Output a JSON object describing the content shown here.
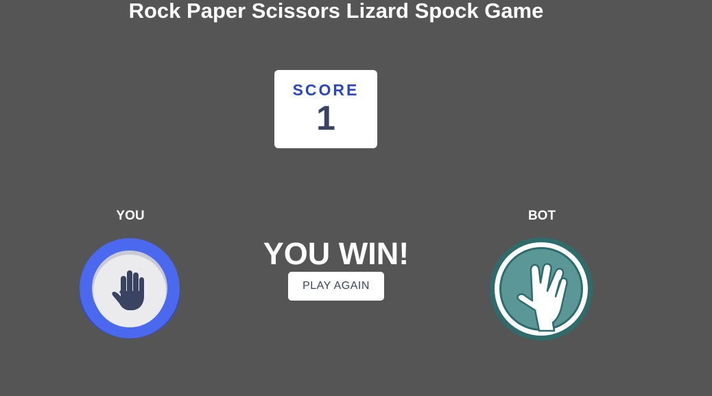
{
  "title": "Rock Paper Scissors Lizard Spock Game",
  "score": {
    "label": "SCORE",
    "value": "1"
  },
  "players": {
    "you_label": "YOU",
    "bot_label": "BOT"
  },
  "picks": {
    "you": "paper-icon",
    "bot": "spock-icon"
  },
  "result": {
    "text": "YOU WIN!",
    "button_label": "PLAY AGAIN"
  },
  "colors": {
    "background": "#555555",
    "paper_ring": "#4a69ee",
    "spock_ring": "#2e6c6c",
    "score_label": "#2a46c0",
    "score_value": "#3b4363"
  }
}
